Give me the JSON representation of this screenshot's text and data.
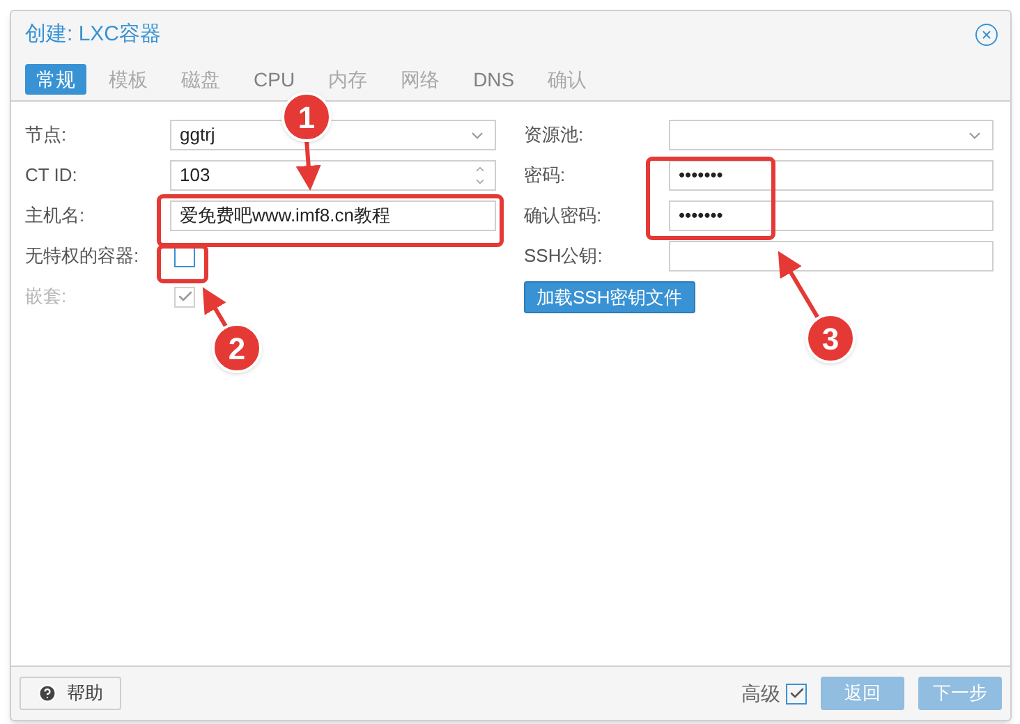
{
  "dialog": {
    "title": "创建: LXC容器"
  },
  "tabs": [
    {
      "label": "常规",
      "selected": true,
      "disabled": false
    },
    {
      "label": "模板",
      "selected": false,
      "disabled": true
    },
    {
      "label": "磁盘",
      "selected": false,
      "disabled": true
    },
    {
      "label": "CPU",
      "selected": false,
      "disabled": false
    },
    {
      "label": "内存",
      "selected": false,
      "disabled": true
    },
    {
      "label": "网络",
      "selected": false,
      "disabled": true
    },
    {
      "label": "DNS",
      "selected": false,
      "disabled": false
    },
    {
      "label": "确认",
      "selected": false,
      "disabled": true
    }
  ],
  "left_fields": [
    {
      "label": "节点:",
      "kind": "select",
      "value": "ggtrj",
      "disabled": false
    },
    {
      "label": "CT ID:",
      "kind": "spinner",
      "value": "103",
      "disabled": false
    },
    {
      "label": "主机名:",
      "kind": "text",
      "value": "爱免费吧www.imf8.cn教程",
      "disabled": false
    },
    {
      "label": "无特权的容器:",
      "kind": "checkbox",
      "checked": false,
      "disabled": false
    },
    {
      "label": "嵌套:",
      "kind": "checkbox",
      "checked": true,
      "disabled": true
    }
  ],
  "right_fields": [
    {
      "label": "资源池:",
      "kind": "select",
      "disabled": false
    },
    {
      "label": "密码:",
      "kind": "text",
      "value": "•••••••",
      "disabled": false
    },
    {
      "label": "确认密码:",
      "kind": "text",
      "value": "•••••••",
      "disabled": false
    },
    {
      "label": "SSH公钥:",
      "kind": "text",
      "disabled": false
    }
  ],
  "ssh_button": "加载SSH密钥文件",
  "footer": {
    "help": "帮助",
    "advanced": {
      "label": "高级",
      "checked": true
    },
    "buttons": [
      {
        "label": "返回",
        "disabled": true
      },
      {
        "label": "下一步",
        "disabled": true
      }
    ]
  },
  "annotations": [
    {
      "number": "1"
    },
    {
      "number": "2"
    },
    {
      "number": "3"
    }
  ]
}
